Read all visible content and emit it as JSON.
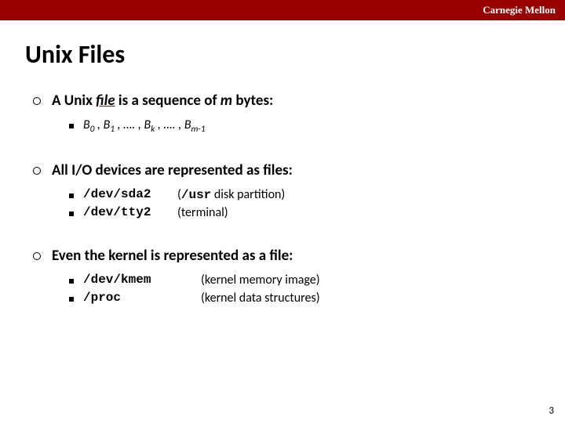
{
  "brand": "Carnegie Mellon",
  "title": "Unix Files",
  "bullets": {
    "b1": {
      "pre": "A Unix ",
      "em": "file",
      "post": " is a sequence of ",
      "m": "m",
      "post2": " bytes:"
    },
    "seq": {
      "b": "B",
      "i0": "0",
      "sep": " , ",
      "i1": "1",
      "dots": " , …. , ",
      "ik": "k",
      "im": "m-1"
    },
    "b2": "All I/O devices are represented as files:",
    "dev1": {
      "code": "/dev/sda2",
      "desc_pre": "(",
      "desc_mono": "/usr",
      "desc_post": " disk partition)"
    },
    "dev2": {
      "code": "/dev/tty2",
      "desc": "(terminal)"
    },
    "b3": "Even the kernel is represented as a file:",
    "k1": {
      "code": "/dev/kmem",
      "desc": "(kernel memory image)"
    },
    "k2": {
      "code": "/proc",
      "desc": "(kernel data structures)"
    }
  },
  "page": "3"
}
